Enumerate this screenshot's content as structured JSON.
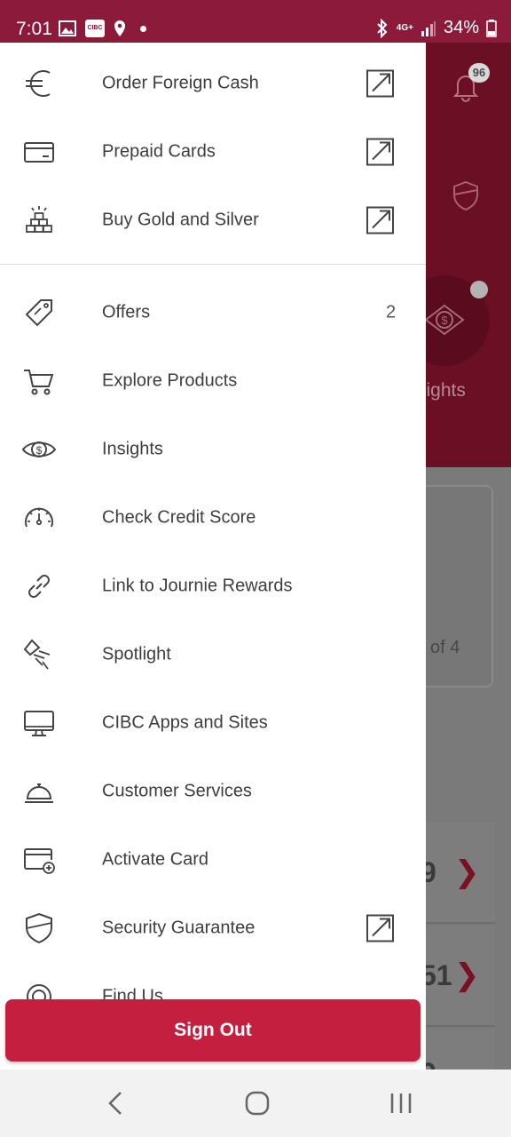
{
  "status_bar": {
    "time": "7:01",
    "battery": "34%",
    "network": "4G+",
    "app_badge": "CIBC"
  },
  "background": {
    "notification_count": "96",
    "insights_label": "sights",
    "page_indicator": "of 4",
    "row1_value": "9",
    "row2_value": "51",
    "row3_value": "9"
  },
  "drawer": {
    "external_items": [
      {
        "label": "Order Foreign Cash",
        "icon": "euro-icon"
      },
      {
        "label": "Prepaid Cards",
        "icon": "card-icon"
      },
      {
        "label": "Buy Gold and Silver",
        "icon": "gold-bars-icon"
      }
    ],
    "items": [
      {
        "label": "Offers",
        "icon": "tag-icon",
        "count": "2"
      },
      {
        "label": "Explore Products",
        "icon": "cart-icon"
      },
      {
        "label": "Insights",
        "icon": "eye-dollar-icon"
      },
      {
        "label": "Check Credit Score",
        "icon": "gauge-icon"
      },
      {
        "label": "Link to Journie Rewards",
        "icon": "link-icon"
      },
      {
        "label": "Spotlight",
        "icon": "spotlight-icon"
      },
      {
        "label": "CIBC Apps and Sites",
        "icon": "monitor-icon"
      },
      {
        "label": "Customer Services",
        "icon": "service-bell-icon"
      },
      {
        "label": "Activate Card",
        "icon": "card-add-icon"
      },
      {
        "label": "Security Guarantee",
        "icon": "shield-icon",
        "external": true
      },
      {
        "label": "Find Us",
        "icon": "location-icon"
      }
    ],
    "sign_out_label": "Sign Out"
  },
  "colors": {
    "brand": "#c41f3e",
    "status_bar": "#8c1a3a",
    "text": "#3d3d3d"
  }
}
